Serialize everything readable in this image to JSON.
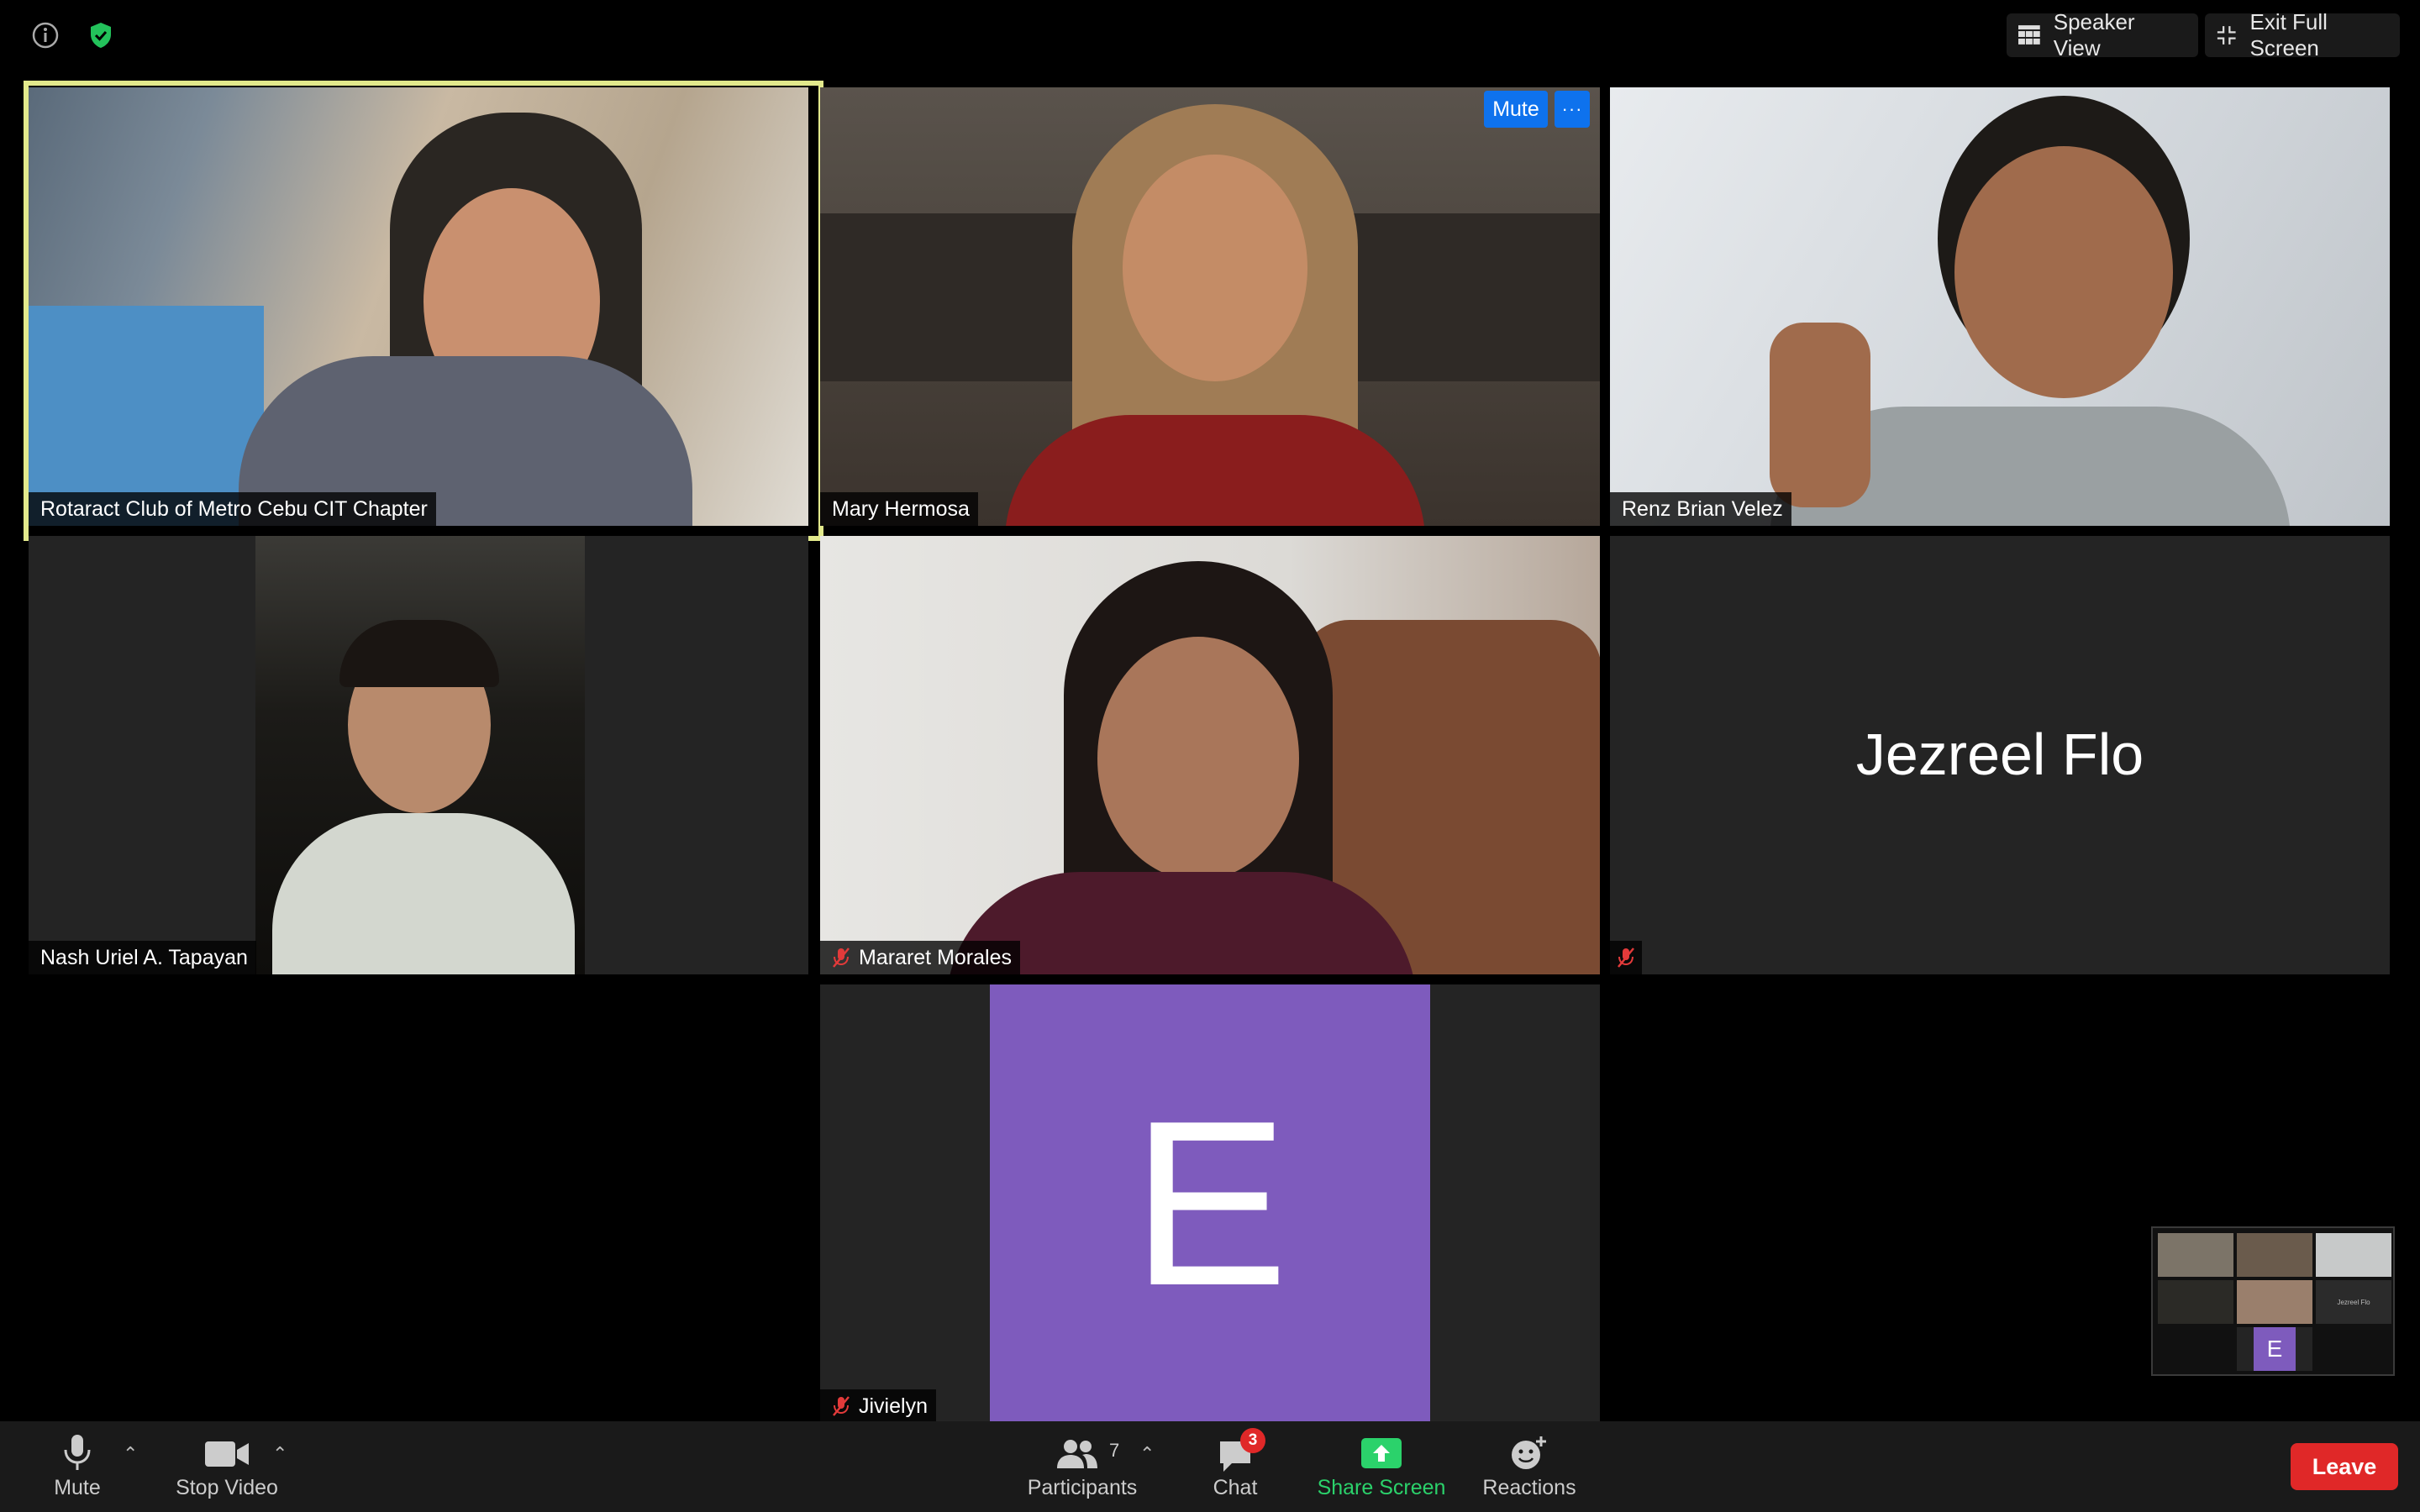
{
  "top_bar": {
    "info_icon": "info-icon",
    "security_icon": "shield-check-icon",
    "speaker_view_label": "Speaker View",
    "exit_fullscreen_label": "Exit Full Screen"
  },
  "tiles": [
    {
      "name": "Rotaract Club of Metro Cebu CIT Chapter",
      "muted": false,
      "active_speaker": true
    },
    {
      "name": "Mary Hermosa",
      "muted": false,
      "hover_controls": {
        "mute": "Mute",
        "more": "···"
      }
    },
    {
      "name": "Renz Brian Velez",
      "muted": false
    },
    {
      "name": "Nash Uriel A. Tapayan",
      "muted": false
    },
    {
      "name": "Mararet Morales",
      "muted": true
    },
    {
      "name": "Jezreel Flo",
      "muted": true,
      "video_off": true
    },
    {
      "name": "Jivielyn",
      "muted": true,
      "avatar_letter": "E",
      "avatar_color": "#7e5bbd"
    }
  ],
  "thumbnail": {
    "avatar_letter": "E",
    "label": "Jezreel Flo"
  },
  "toolbar": {
    "mute_label": "Mute",
    "stop_video_label": "Stop Video",
    "participants_label": "Participants",
    "participants_count": "7",
    "chat_label": "Chat",
    "chat_badge": "3",
    "share_screen_label": "Share Screen",
    "reactions_label": "Reactions",
    "leave_label": "Leave"
  },
  "colors": {
    "active_border": "#e2e98c",
    "share_green": "#2bd26b",
    "leave_red": "#e02828",
    "accent_blue": "#0e72ed"
  }
}
